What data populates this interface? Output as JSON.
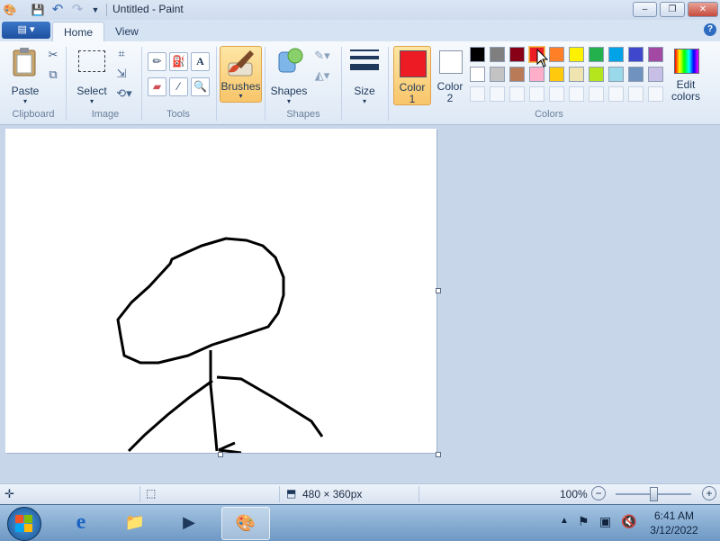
{
  "window": {
    "title": "Untitled - Paint",
    "controls": {
      "minimize": "‒",
      "maximize": "❐",
      "close": "✕"
    }
  },
  "quick_access": {
    "app_icon": "paint-icon",
    "save_icon": "save-icon",
    "undo_icon": "undo-icon",
    "redo_icon": "redo-icon",
    "customize_icon": "chevron-down-icon"
  },
  "tabs": {
    "home": "Home",
    "view": "View",
    "help": "?"
  },
  "ribbon": {
    "clipboard": {
      "label": "Clipboard",
      "paste": "Paste"
    },
    "image": {
      "label": "Image",
      "select": "Select"
    },
    "tools": {
      "label": "Tools"
    },
    "brushes": {
      "label": "Brushes"
    },
    "shapes": {
      "label": "Shapes",
      "shapes_button": "Shapes"
    },
    "size": {
      "label": "Size"
    },
    "colors": {
      "label": "Colors",
      "color1_label": "Color",
      "color1_num": "1",
      "color1_value": "#ed1c24",
      "color2_label": "Color",
      "color2_num": "2",
      "color2_value": "#ffffff",
      "edit_colors": "Edit colors",
      "palette_row1": [
        "#000000",
        "#7f7f7f",
        "#880015",
        "#ed1c24",
        "#ff7f27",
        "#fff200",
        "#22b14c",
        "#00a2e8",
        "#3f48cc",
        "#a349a4"
      ],
      "palette_row2": [
        "#ffffff",
        "#c3c3c3",
        "#b97a57",
        "#ffaec9",
        "#ffc90e",
        "#efe4b0",
        "#b5e61d",
        "#99d9ea",
        "#7092be",
        "#c8bfe7"
      ]
    }
  },
  "status": {
    "canvas_size": "480 × 360px",
    "zoom": "100%",
    "zoom_level": 1.0
  },
  "taskbar": {
    "clock_time": "6:41 AM",
    "clock_date": "3/12/2022"
  }
}
